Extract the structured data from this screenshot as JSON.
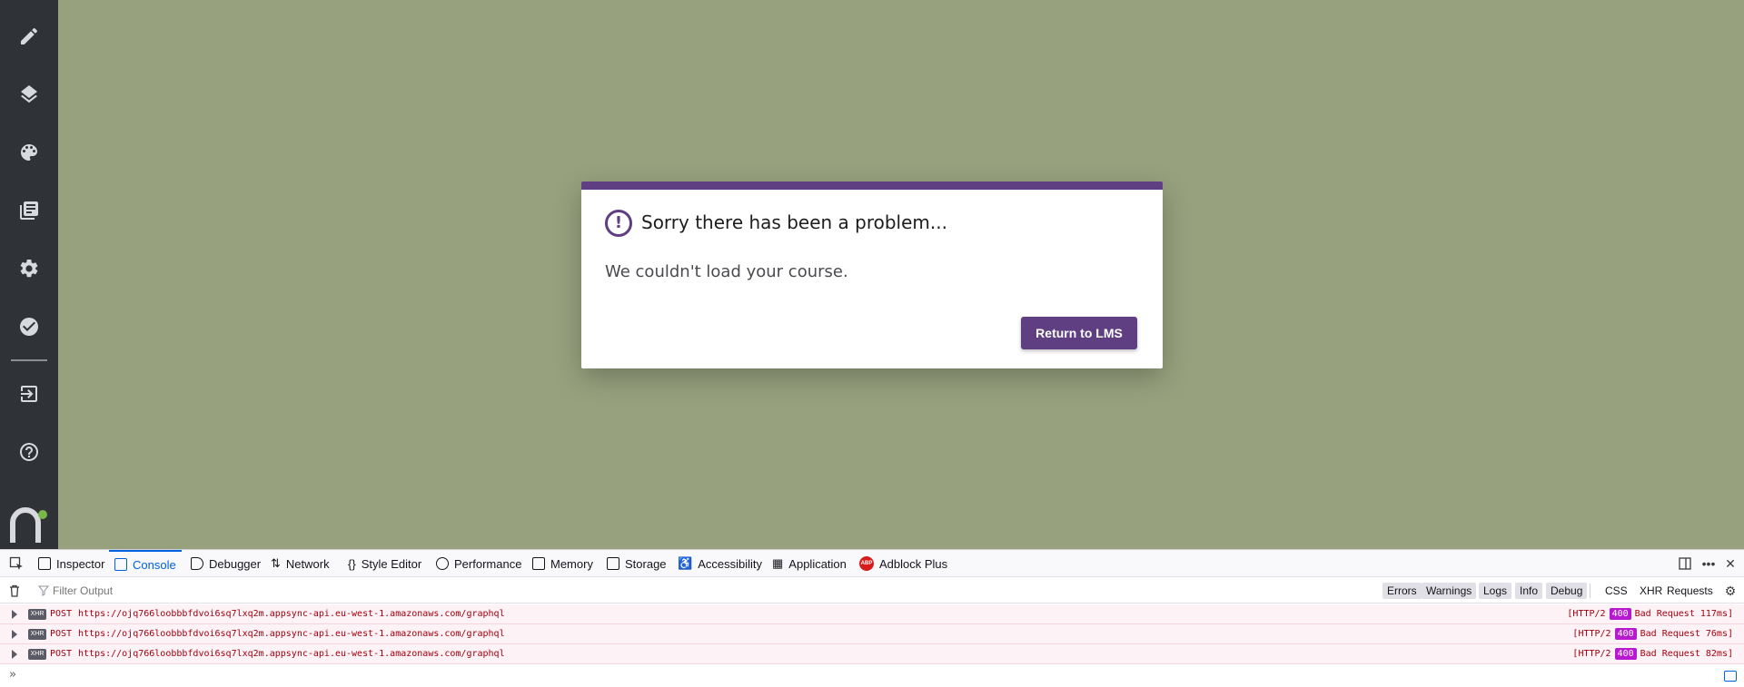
{
  "dialog": {
    "title": "Sorry there has been a problem...",
    "message": "We couldn't load your course.",
    "button_label": "Return to LMS",
    "icon": "alert-circle-icon",
    "accent_color": "#5f3f82"
  },
  "sidebar": {
    "items": [
      {
        "name": "pencil-icon"
      },
      {
        "name": "layers-icon"
      },
      {
        "name": "palette-icon"
      },
      {
        "name": "library-icon"
      },
      {
        "name": "gear-icon"
      },
      {
        "name": "check-circle-icon"
      },
      {
        "name": "exit-icon"
      },
      {
        "name": "help-icon"
      }
    ],
    "logo": "n-logo"
  },
  "devtools": {
    "tabs": [
      {
        "label": "Inspector"
      },
      {
        "label": "Console"
      },
      {
        "label": "Debugger"
      },
      {
        "label": "Network"
      },
      {
        "label": "Style Editor"
      },
      {
        "label": "Performance"
      },
      {
        "label": "Memory"
      },
      {
        "label": "Storage"
      },
      {
        "label": "Accessibility"
      },
      {
        "label": "Application"
      },
      {
        "label": "Adblock Plus"
      }
    ],
    "active_tab": "Console",
    "filter_placeholder": "Filter Output",
    "level_filters": [
      "Errors",
      "Warnings",
      "Logs",
      "Info",
      "Debug"
    ],
    "type_filters": [
      "CSS",
      "XHR",
      "Requests"
    ],
    "logs": [
      {
        "badge": "XHR",
        "method": "POST",
        "url": "https://ojq766loobbbfdvoi6sq7lxq2m.appsync-api.eu-west-1.amazonaws.com/graphql",
        "protocol": "[HTTP/2",
        "code": "400",
        "status": "Bad Request 117ms]"
      },
      {
        "badge": "XHR",
        "method": "POST",
        "url": "https://ojq766loobbbfdvoi6sq7lxq2m.appsync-api.eu-west-1.amazonaws.com/graphql",
        "protocol": "[HTTP/2",
        "code": "400",
        "status": "Bad Request 76ms]"
      },
      {
        "badge": "XHR",
        "method": "POST",
        "url": "https://ojq766loobbbfdvoi6sq7lxq2m.appsync-api.eu-west-1.amazonaws.com/graphql",
        "protocol": "[HTTP/2",
        "code": "400",
        "status": "Bad Request 82ms]"
      }
    ],
    "prompt": "»"
  }
}
